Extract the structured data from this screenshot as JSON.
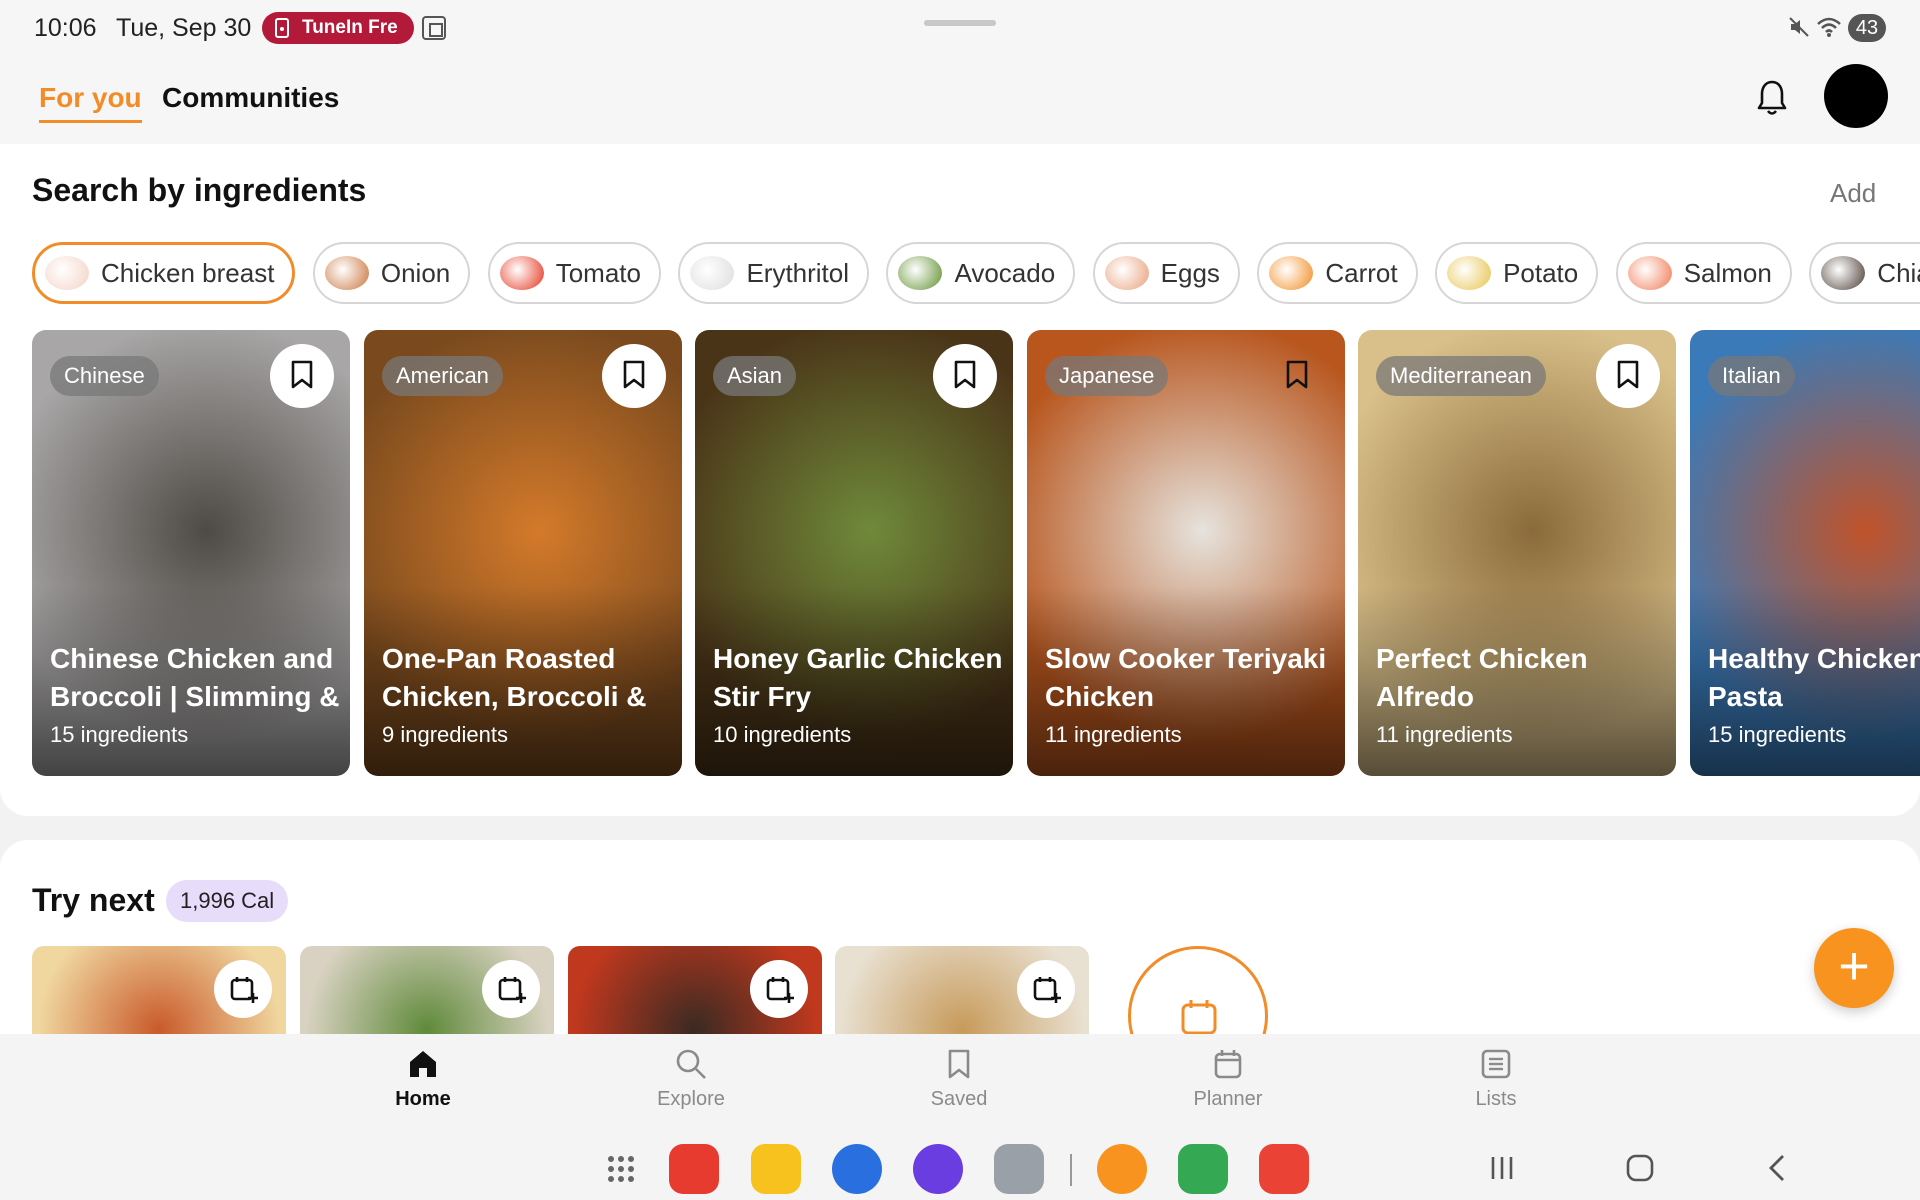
{
  "status_bar": {
    "time": "10:06",
    "date": "Tue, Sep 30",
    "notification_pill": "TuneIn Fre",
    "battery": "43"
  },
  "header": {
    "tabs": [
      {
        "label": "For you",
        "active": true
      },
      {
        "label": "Communities",
        "active": false
      }
    ],
    "bell_icon": "bell-icon",
    "avatar_icon": "avatar"
  },
  "ingredients": {
    "title": "Search by ingredients",
    "add_label": "Add",
    "chips": [
      {
        "label": "Chicken breast",
        "active": true,
        "color": "#f3d1c4"
      },
      {
        "label": "Onion",
        "active": false,
        "color": "#c9733a"
      },
      {
        "label": "Tomato",
        "active": false,
        "color": "#e4321b"
      },
      {
        "label": "Erythritol",
        "active": false,
        "color": "#dcdcdc"
      },
      {
        "label": "Avocado",
        "active": false,
        "color": "#5f8f2e"
      },
      {
        "label": "Eggs",
        "active": false,
        "color": "#e8a07a"
      },
      {
        "label": "Carrot",
        "active": false,
        "color": "#f38a1e"
      },
      {
        "label": "Potato",
        "active": false,
        "color": "#e6c24a"
      },
      {
        "label": "Salmon",
        "active": false,
        "color": "#f07850"
      },
      {
        "label": "Chia seeds",
        "active": false,
        "color": "#4a3a33"
      }
    ]
  },
  "recipes": [
    {
      "tag": "Chinese",
      "title": "Chinese Chicken and Broccoli | Slimming &",
      "ingredients": "15 ingredients",
      "color": "#a8a6a6",
      "color2": "#4e4a45"
    },
    {
      "tag": "American",
      "title": "One-Pan Roasted Chicken, Broccoli &",
      "ingredients": "9 ingredients",
      "color": "#7a4a1e",
      "color2": "#d47a2a"
    },
    {
      "tag": "Asian",
      "title": "Honey Garlic Chicken Stir Fry",
      "ingredients": "10 ingredients",
      "color": "#4a3418",
      "color2": "#6f8a3a"
    },
    {
      "tag": "Japanese",
      "title": "Slow Cooker Teriyaki Chicken",
      "ingredients": "11 ingredients",
      "color": "#b8561e",
      "color2": "#e6e3dd"
    },
    {
      "tag": "Mediterranean",
      "title": "Perfect Chicken Alfredo",
      "ingredients": "11 ingredients",
      "color": "#d9c08a",
      "color2": "#8a6a3a"
    },
    {
      "tag": "Italian",
      "title": "Healthy Chicken Pasta",
      "ingredients": "15 ingredients",
      "color": "#3a7ab8",
      "color2": "#c0532a"
    }
  ],
  "try_next": {
    "title": "Try next",
    "calories": "1,996 Cal",
    "thumbs": [
      {
        "color": "#c95a2a",
        "color2": "#f0d7a0"
      },
      {
        "color": "#5f8a3a",
        "color2": "#d9d2c2"
      },
      {
        "color": "#3a2a22",
        "color2": "#c0381e"
      },
      {
        "color": "#c79a5a",
        "color2": "#e8e0d0"
      }
    ]
  },
  "fab_label": "+",
  "bottom_nav": [
    {
      "label": "Home",
      "icon": "home-icon",
      "active": true
    },
    {
      "label": "Explore",
      "icon": "search-icon",
      "active": false
    },
    {
      "label": "Saved",
      "icon": "bookmark-icon",
      "active": false
    },
    {
      "label": "Planner",
      "icon": "calendar-icon",
      "active": false
    },
    {
      "label": "Lists",
      "icon": "list-icon",
      "active": false
    }
  ],
  "taskbar_apps": [
    {
      "name": "app-drawer-icon",
      "color": "#777777"
    },
    {
      "name": "notes-app-icon",
      "color": "#e63b2e"
    },
    {
      "name": "files-app-icon",
      "color": "#f7c21e"
    },
    {
      "name": "messages-app-icon",
      "color": "#2a6fe0"
    },
    {
      "name": "browser-app-icon",
      "color": "#6a3de0"
    },
    {
      "name": "camera-app-icon",
      "color": "#9aa0a8"
    },
    {
      "name": "recipes-app-icon",
      "color": "#f7931e"
    },
    {
      "name": "drive-app-icon",
      "color": "#34a853"
    },
    {
      "name": "gmail-app-icon",
      "color": "#ea4335"
    }
  ]
}
